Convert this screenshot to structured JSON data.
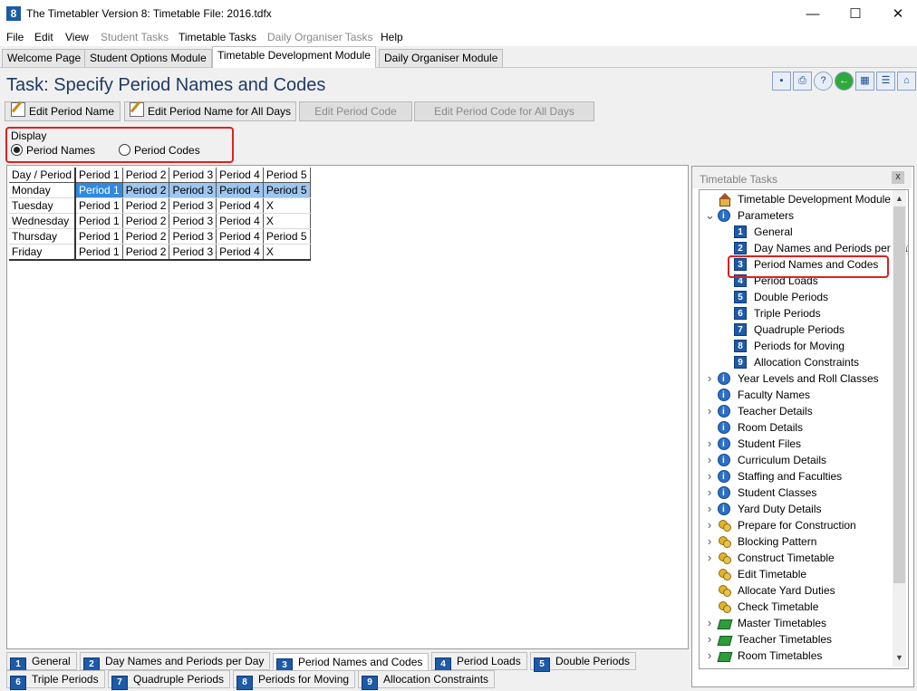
{
  "window": {
    "title": "The Timetabler Version 8: Timetable File: 2016.tdfx",
    "app_icon": "8",
    "minimize": "—",
    "maximize": "☐",
    "close": "✕"
  },
  "menu": [
    "File",
    "Edit",
    "View",
    "Student Tasks",
    "Timetable Tasks",
    "Daily Organiser Tasks",
    "Help"
  ],
  "module_tabs": [
    "Welcome Page",
    "Student Options Module",
    "Timetable Development Module",
    "Daily Organiser Module"
  ],
  "task_title": "Task: Specify Period Names and Codes",
  "toolbar_icons": [
    "save-icon",
    "print-icon",
    "help-icon",
    "back-icon",
    "calendar-icon",
    "tree-icon",
    "home-icon"
  ],
  "command_buttons": [
    "Edit Period Name",
    "Edit Period Name for All Days",
    "Edit Period Code",
    "Edit Period Code for All Days"
  ],
  "display": {
    "label": "Display",
    "option_names": "Period Names",
    "option_codes": "Period Codes",
    "selected": "Period Names"
  },
  "grid": {
    "headers": [
      "Day / Period",
      "Period 1",
      "Period 2",
      "Period 3",
      "Period 4",
      "Period 5"
    ],
    "rows": [
      [
        "Monday",
        "Period 1",
        "Period 2",
        "Period 3",
        "Period 4",
        "Period 5"
      ],
      [
        "Tuesday",
        "Period 1",
        "Period 2",
        "Period 3",
        "Period 4",
        "X"
      ],
      [
        "Wednesday",
        "Period 1",
        "Period 2",
        "Period 3",
        "Period 4",
        "X"
      ],
      [
        "Thursday",
        "Period 1",
        "Period 2",
        "Period 3",
        "Period 4",
        "Period 5"
      ],
      [
        "Friday",
        "Period 1",
        "Period 2",
        "Period 3",
        "Period 4",
        "X"
      ]
    ]
  },
  "tasks_panel": {
    "title": "Timetable Tasks",
    "close": "x",
    "tree": [
      {
        "label": "Timetable Development Module",
        "icon": "house",
        "level": 0,
        "arrow": ""
      },
      {
        "label": "Parameters",
        "icon": "info",
        "level": 0,
        "arrow": "v"
      },
      {
        "label": "General",
        "icon": "num",
        "num": "1",
        "level": 1,
        "arrow": ""
      },
      {
        "label": "Day Names and Periods per Day",
        "icon": "num",
        "num": "2",
        "level": 1,
        "arrow": ""
      },
      {
        "label": "Period Names and Codes",
        "icon": "num",
        "num": "3",
        "level": 1,
        "arrow": "",
        "selected": true
      },
      {
        "label": "Period Loads",
        "icon": "num",
        "num": "4",
        "level": 1,
        "arrow": ""
      },
      {
        "label": "Double Periods",
        "icon": "num",
        "num": "5",
        "level": 1,
        "arrow": ""
      },
      {
        "label": "Triple Periods",
        "icon": "num",
        "num": "6",
        "level": 1,
        "arrow": ""
      },
      {
        "label": "Quadruple Periods",
        "icon": "num",
        "num": "7",
        "level": 1,
        "arrow": ""
      },
      {
        "label": "Periods for Moving",
        "icon": "num",
        "num": "8",
        "level": 1,
        "arrow": ""
      },
      {
        "label": "Allocation Constraints",
        "icon": "num",
        "num": "9",
        "level": 1,
        "arrow": ""
      },
      {
        "label": "Year Levels and Roll Classes",
        "icon": "info",
        "level": 0,
        "arrow": ">"
      },
      {
        "label": "Faculty Names",
        "icon": "info",
        "level": 0,
        "arrow": ""
      },
      {
        "label": "Teacher Details",
        "icon": "info",
        "level": 0,
        "arrow": ">"
      },
      {
        "label": "Room Details",
        "icon": "info",
        "level": 0,
        "arrow": ""
      },
      {
        "label": "Student Files",
        "icon": "info",
        "level": 0,
        "arrow": ">"
      },
      {
        "label": "Curriculum Details",
        "icon": "info",
        "level": 0,
        "arrow": ">"
      },
      {
        "label": "Staffing and Faculties",
        "icon": "info",
        "level": 0,
        "arrow": ">"
      },
      {
        "label": "Student Classes",
        "icon": "info",
        "level": 0,
        "arrow": ">"
      },
      {
        "label": "Yard Duty Details",
        "icon": "info",
        "level": 0,
        "arrow": ">"
      },
      {
        "label": "Prepare for Construction",
        "icon": "gear",
        "level": 0,
        "arrow": ">"
      },
      {
        "label": "Blocking Pattern",
        "icon": "gear",
        "level": 0,
        "arrow": ">"
      },
      {
        "label": "Construct Timetable",
        "icon": "gear",
        "level": 0,
        "arrow": ">"
      },
      {
        "label": "Edit Timetable",
        "icon": "gear",
        "level": 0,
        "arrow": ""
      },
      {
        "label": "Allocate Yard Duties",
        "icon": "gear",
        "level": 0,
        "arrow": ""
      },
      {
        "label": "Check Timetable",
        "icon": "gear",
        "level": 0,
        "arrow": ""
      },
      {
        "label": "Master Timetables",
        "icon": "book",
        "level": 0,
        "arrow": ">"
      },
      {
        "label": "Teacher Timetables",
        "icon": "book",
        "level": 0,
        "arrow": ">"
      },
      {
        "label": "Room Timetables",
        "icon": "book",
        "level": 0,
        "arrow": ">"
      }
    ]
  },
  "bottom_tabs_row1": [
    {
      "num": "1",
      "label": "General"
    },
    {
      "num": "2",
      "label": "Day Names and Periods per Day"
    },
    {
      "num": "3",
      "label": "Period Names and Codes",
      "active": true
    },
    {
      "num": "4",
      "label": "Period Loads"
    },
    {
      "num": "5",
      "label": "Double Periods"
    }
  ],
  "bottom_tabs_row2": [
    {
      "num": "6",
      "label": "Triple Periods"
    },
    {
      "num": "7",
      "label": "Quadruple Periods"
    },
    {
      "num": "8",
      "label": "Periods for Moving"
    },
    {
      "num": "9",
      "label": "Allocation Constraints"
    }
  ]
}
